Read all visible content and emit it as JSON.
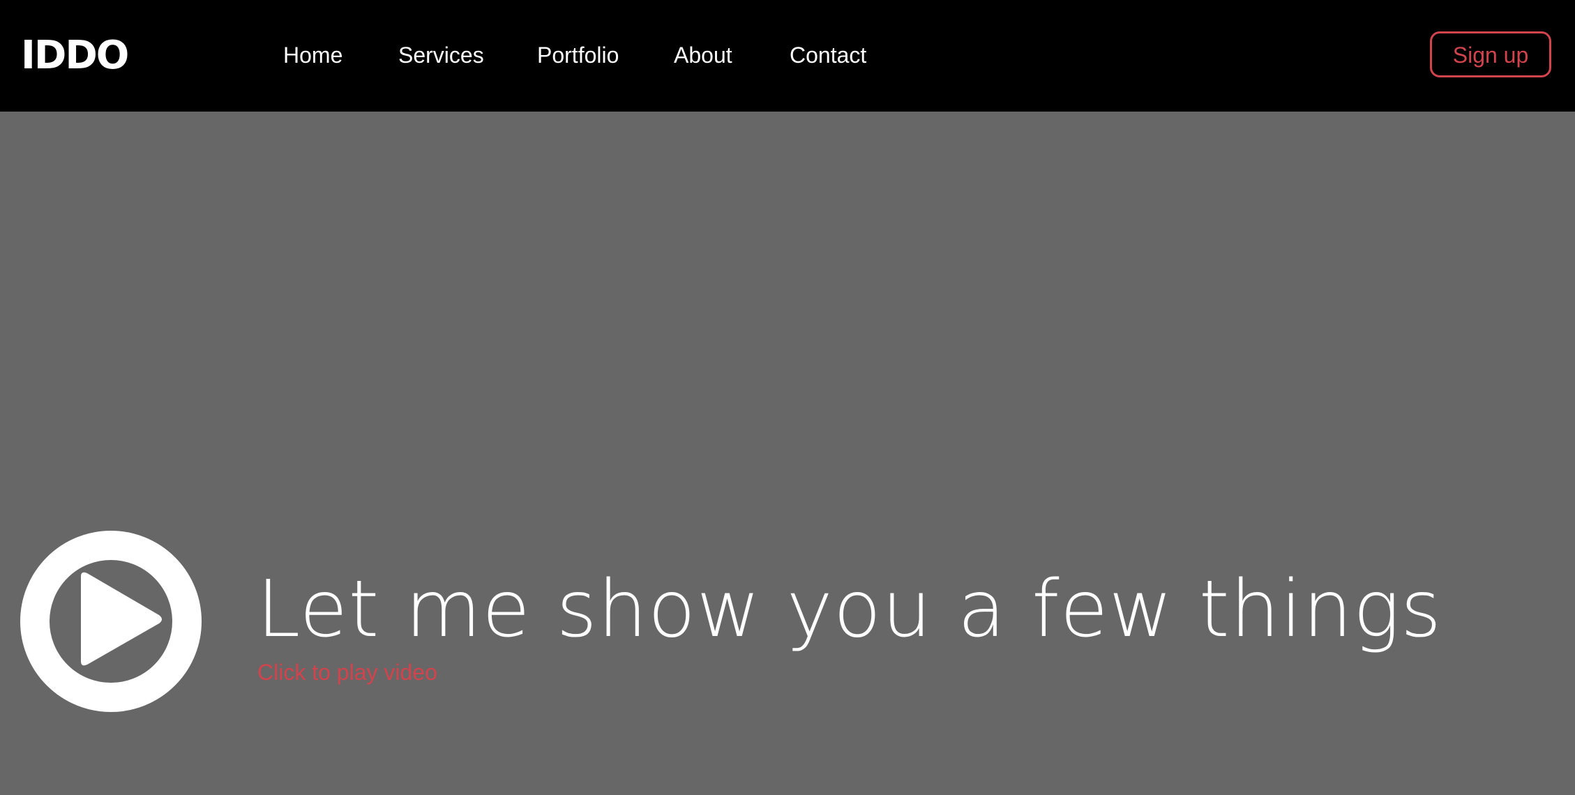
{
  "header": {
    "logo": "IDDO",
    "nav": [
      {
        "label": "Home"
      },
      {
        "label": "Services"
      },
      {
        "label": "Portfolio"
      },
      {
        "label": "About"
      },
      {
        "label": "Contact"
      }
    ],
    "signup_label": "Sign up"
  },
  "hero": {
    "headline": "Let me show you a few things",
    "subtext": "Click to play video",
    "play_icon": "play-circle-icon"
  },
  "colors": {
    "nav_background": "#000000",
    "hero_background": "#676767",
    "accent": "#d1434d",
    "text": "#ffffff"
  }
}
